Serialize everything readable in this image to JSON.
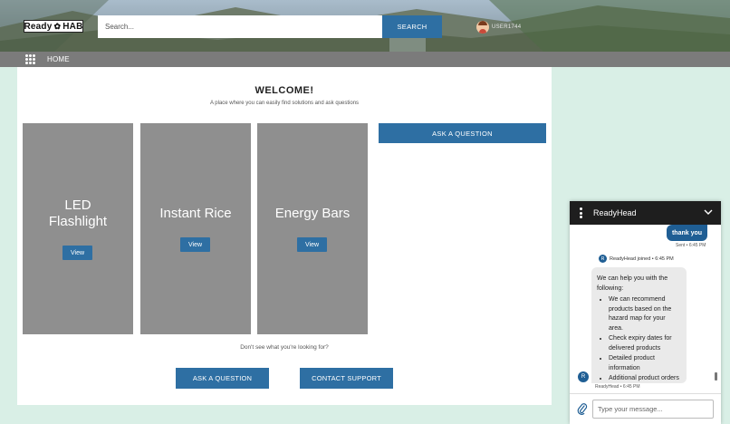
{
  "header": {
    "logo_text_left": "Ready",
    "logo_text_right": "HAB",
    "search_placeholder": "Search...",
    "search_button": "SEARCH",
    "username": "USER1744"
  },
  "nav": {
    "home_label": "HOME"
  },
  "main": {
    "title": "WELCOME!",
    "tagline": "A place where you can easily find solutions and ask questions",
    "cards": [
      {
        "title": "LED Flashlight",
        "button": "View"
      },
      {
        "title": "Instant Rice",
        "button": "View"
      },
      {
        "title": "Energy Bars",
        "button": "View"
      }
    ],
    "ask_question_top": "ASK A QUESTION",
    "not_found_text": "Don't see what you're looking for?",
    "ask_question_bottom": "ASK A QUESTION",
    "contact_support": "CONTACT SUPPORT"
  },
  "chat": {
    "title": "ReadyHead",
    "outgoing_message": "thank you",
    "sent_status": "Sent • 6:45 PM",
    "avatar_initial": "R",
    "joined_text": "ReadyHead joined • 6:45 PM",
    "incoming_intro": "We can help you with the following:",
    "incoming_items": [
      "We can recommend products based on the hazard map for your area.",
      "Check expiry dates for delivered products",
      "Detailed product information",
      "Additional product orders"
    ],
    "agent_timestamp": "ReadyHead • 6:45 PM",
    "input_placeholder": "Type your message..."
  },
  "colors": {
    "accent": "#2e6fa3",
    "card_bg": "#8f8f8f",
    "page_bg": "#d9efe6",
    "chat_header": "#1e1e1e",
    "nav_bg": "#7b7b7b"
  },
  "icons": [
    "apps-grid-icon",
    "gear-icon",
    "user-avatar",
    "kebab-menu-icon",
    "chevron-down-icon",
    "paperclip-icon"
  ]
}
